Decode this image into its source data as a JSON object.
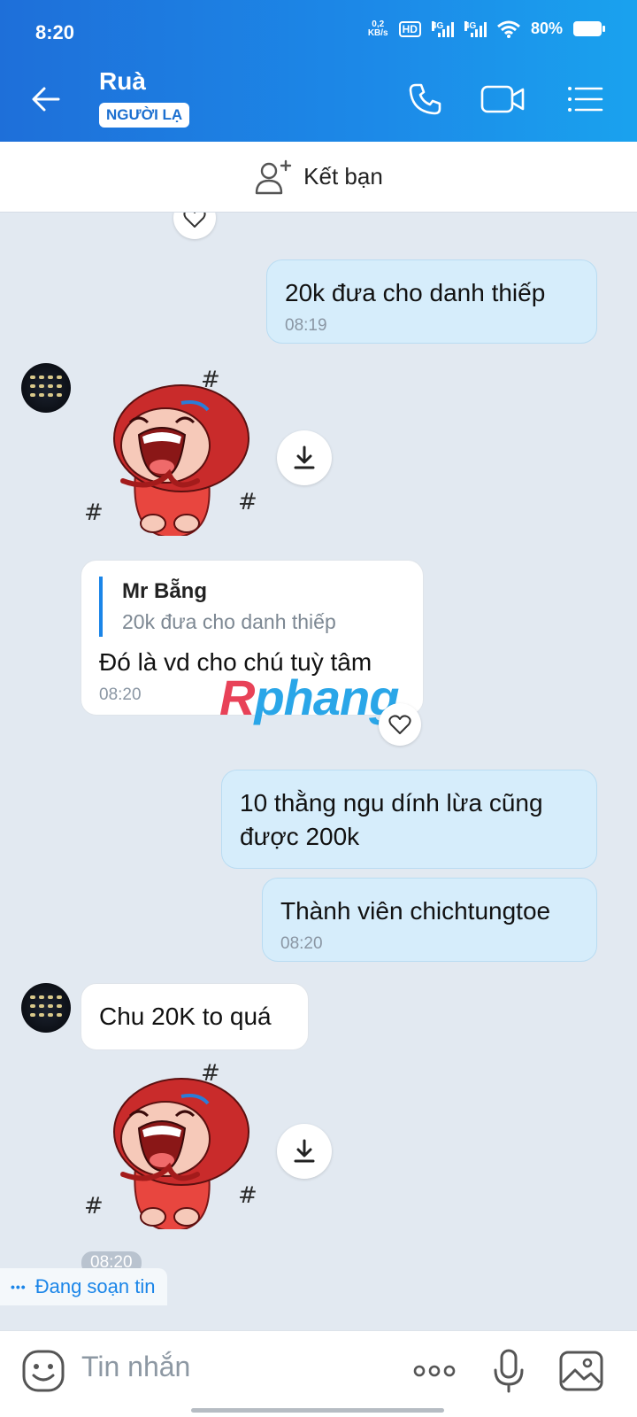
{
  "status_bar": {
    "time": "8:20",
    "net_speed_value": "0,2",
    "net_speed_unit": "KB/s",
    "hd_badge": "HD",
    "sim1_network": "4G",
    "sim2_network": "4G",
    "battery": "80%"
  },
  "header": {
    "contact_name": "Ruà",
    "badge": "NGƯỜI LẠ"
  },
  "friend_bar": {
    "label": "Kết bạn"
  },
  "messages": [
    {
      "text": "20k đưa cho danh thiếp",
      "time": "08:19"
    },
    {
      "quote_name": "Mr Bẵng",
      "quote_text": "20k đưa cho danh thiếp",
      "text": "Đó là vd cho chú tuỳ tâm",
      "time": "08:20"
    },
    {
      "text": "10 thằng ngu dính lừa cũng được 200k"
    },
    {
      "text": "Thành viên chichtungtoe",
      "time": "08:20"
    },
    {
      "text": "Chu 20K to quá"
    }
  ],
  "watermark": {
    "part1": "R",
    "part2": "phang"
  },
  "sticker_time": "08:20",
  "typing_indicator": "Đang soạn tin",
  "input": {
    "placeholder": "Tin nhắn"
  },
  "colors": {
    "header_blue": "#1c8ae8",
    "outgoing_bubble": "#d6edfb",
    "incoming_bubble": "#ffffff",
    "chat_background": "#e2e9f1",
    "accent": "#1a85e8"
  },
  "icons": [
    "back-arrow-icon",
    "phone-icon",
    "video-call-icon",
    "menu-list-icon",
    "add-friend-icon",
    "heart-icon",
    "download-icon",
    "emoji-icon",
    "more-icon",
    "microphone-icon",
    "image-icon"
  ]
}
